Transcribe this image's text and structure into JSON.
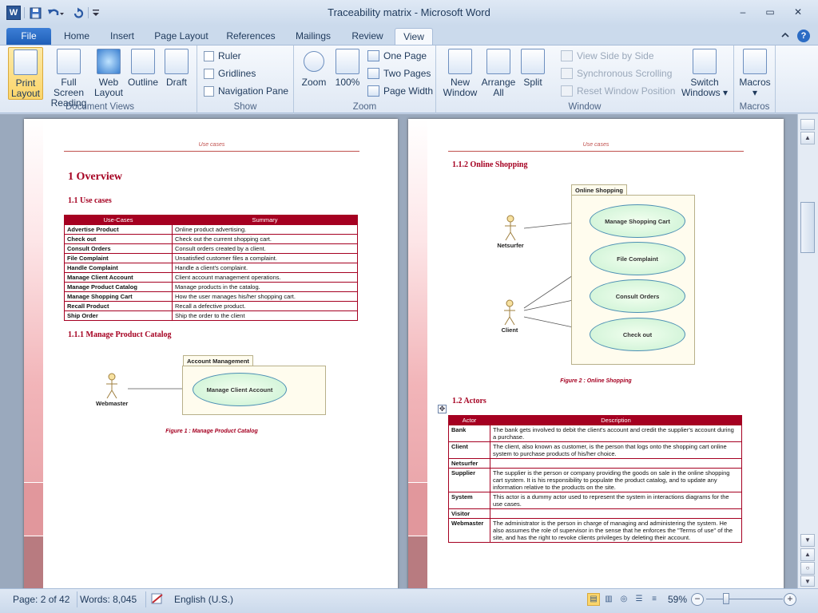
{
  "window": {
    "title": "Traceability matrix  -  Microsoft Word",
    "app_icon": "W",
    "controls": {
      "minimize": "–",
      "restore": "▭",
      "close": "✕"
    }
  },
  "quick_access": {
    "icons": [
      "save-icon",
      "undo-icon",
      "redo-icon",
      "customize-icon"
    ]
  },
  "tabs": [
    {
      "label": "File"
    },
    {
      "label": "Home"
    },
    {
      "label": "Insert"
    },
    {
      "label": "Page Layout"
    },
    {
      "label": "References"
    },
    {
      "label": "Mailings"
    },
    {
      "label": "Review"
    },
    {
      "label": "View"
    }
  ],
  "active_tab": "View",
  "ribbon": {
    "document_views": {
      "label": "Document Views",
      "buttons": [
        {
          "line1": "Print",
          "line2": "Layout"
        },
        {
          "line1": "Full Screen",
          "line2": "Reading"
        },
        {
          "line1": "Web",
          "line2": "Layout"
        },
        {
          "line1": "Outline",
          "line2": ""
        },
        {
          "line1": "Draft",
          "line2": ""
        }
      ]
    },
    "show": {
      "label": "Show",
      "items": [
        "Ruler",
        "Gridlines",
        "Navigation Pane"
      ]
    },
    "zoom": {
      "label": "Zoom",
      "zoom_btn": "Zoom",
      "hundred_btn": "100%",
      "one_page": "One Page",
      "two_pages": "Two Pages",
      "page_width": "Page Width"
    },
    "window": {
      "label": "Window",
      "new_window": {
        "line1": "New",
        "line2": "Window"
      },
      "arrange_all": {
        "line1": "Arrange",
        "line2": "All"
      },
      "split": "Split",
      "view_side": "View Side by Side",
      "sync_scroll": "Synchronous Scrolling",
      "reset_pos": "Reset Window Position",
      "switch_windows": {
        "line1": "Switch",
        "line2": "Windows ▾"
      }
    },
    "macros": {
      "label": "Macros",
      "btn": "Macros",
      "arrow": "▾"
    }
  },
  "left_page": {
    "header": "Use cases",
    "h1": "1   Overview",
    "h2": "1.1    Use cases",
    "usecase_table": {
      "headers": [
        "Use-Cases",
        "Summary"
      ],
      "rows": [
        [
          "Advertise Product",
          "Online product advertising."
        ],
        [
          "Check out",
          "Check out the current shopping cart."
        ],
        [
          "Consult Orders",
          "Consult orders created by a client."
        ],
        [
          "File Complaint",
          "Unsatisfied customer files a complaint."
        ],
        [
          "Handle Complaint",
          "Handle a client's complaint."
        ],
        [
          "Manage Client Account",
          "Client account management operations."
        ],
        [
          "Manage Product Catalog",
          "Manage products in the catalog."
        ],
        [
          "Manage Shopping Cart",
          "How the user manages his/her shopping cart."
        ],
        [
          "Recall Product",
          "Recall a defective product."
        ],
        [
          "Ship Order",
          "Ship the order to the client"
        ]
      ]
    },
    "h3": "1.1.1    Manage Product Catalog",
    "diagram": {
      "package": "Account Management",
      "usecase": "Manage Client Account",
      "actor": "Webmaster"
    },
    "caption": "Figure 1 : Manage Product Catalog"
  },
  "right_page": {
    "header": "Use cases",
    "h3": "1.1.2    Online Shopping",
    "diagram": {
      "package": "Online Shopping",
      "usecases": [
        "Manage Shopping Cart",
        "File Complaint",
        "Consult Orders",
        "Check out"
      ],
      "actors": [
        "Netsurfer",
        "Client"
      ]
    },
    "caption": "Figure 2 : Online Shopping",
    "h2": "1.2    Actors",
    "actor_table": {
      "headers": [
        "Actor",
        "Description"
      ],
      "rows": [
        [
          "Bank",
          "The bank gets involved to debit the client's account and credit the supplier's account during a purchase."
        ],
        [
          "Client",
          "The client, also known as customer, is the person that logs onto the shopping cart online system to purchase products of his/her choice."
        ],
        [
          "Netsurfer",
          ""
        ],
        [
          "Supplier",
          "The supplier is the person or company providing the goods on sale in the online shopping cart system. It is his responsibility to populate the product catalog, and to update any information relative to the products on the site."
        ],
        [
          "System",
          "This actor is a dummy actor used to represent the system in interactions diagrams for the use cases."
        ],
        [
          "Visitor",
          ""
        ],
        [
          "Webmaster",
          "The administrator is the person in charge of managing and administering the system. He also assumes the role of supervisor in the sense that he enforces the \"Terms of use\" of the site, and has the right to revoke clients privileges by deleting their account."
        ]
      ]
    }
  },
  "status_bar": {
    "page": "Page: 2 of 42",
    "words": "Words: 8,045",
    "language": "English (U.S.)",
    "zoom": "59%",
    "zoom_minus": "−",
    "zoom_plus": "+"
  }
}
